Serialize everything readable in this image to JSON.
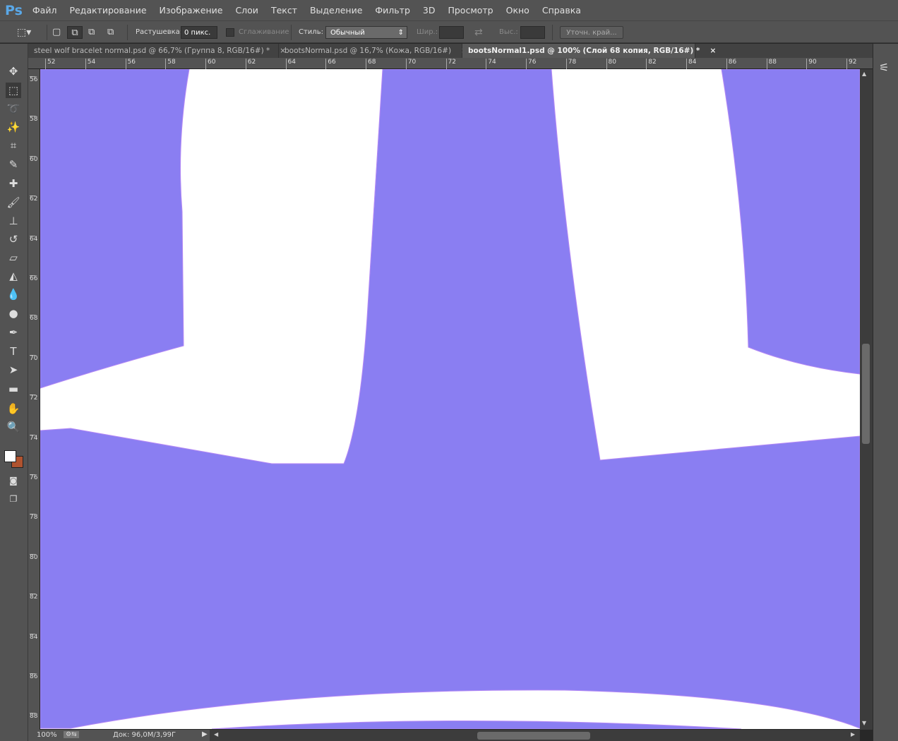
{
  "app": {
    "logo": "Ps"
  },
  "menu": [
    "Файл",
    "Редактирование",
    "Изображение",
    "Слои",
    "Текст",
    "Выделение",
    "Фильтр",
    "3D",
    "Просмотр",
    "Окно",
    "Справка"
  ],
  "options": {
    "feather_label": "Растушевка:",
    "feather_value": "0 пикс.",
    "antialias_label": "Сглаживание",
    "style_label": "Стиль:",
    "style_value": "Обычный",
    "width_label": "Шир.:",
    "height_label": "Выс.:",
    "refine_edge": "Уточн. край..."
  },
  "tabs": [
    {
      "label": "steel wolf bracelet normal.psd @ 66,7% (Группа 8, RGB/16#) *",
      "close": "×",
      "active": false
    },
    {
      "label": "bootsNormal.psd @ 16,7% (Кожа, RGB/16#)",
      "close": "×",
      "active": false
    },
    {
      "label": "bootsNormal1.psd @ 100% (Слой 68 копия, RGB/16#) *",
      "close": "×",
      "active": true
    }
  ],
  "hruler": [
    "52",
    "54",
    "56",
    "58",
    "60",
    "62",
    "64",
    "66",
    "68",
    "70",
    "72",
    "74",
    "76",
    "78",
    "80",
    "82",
    "84",
    "86",
    "88",
    "90",
    "92"
  ],
  "vruler": [
    "56",
    "58",
    "60",
    "62",
    "64",
    "66",
    "68",
    "70",
    "72",
    "74",
    "76",
    "78",
    "80",
    "82",
    "84",
    "86",
    "88"
  ],
  "status": {
    "zoom": "100%",
    "doc": "Док: 96,0M/3,99Г"
  },
  "colors": {
    "normal_map": "#8a7ef2",
    "foreground": "#ffffff",
    "background": "#b0532f"
  }
}
